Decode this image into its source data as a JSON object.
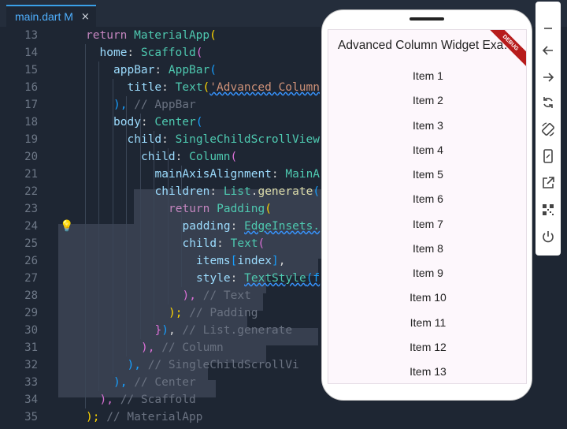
{
  "editor": {
    "tab": {
      "title": "main.dart M",
      "close": "×"
    },
    "lines": [
      {
        "n": "13",
        "indent": 1,
        "tokens": [
          [
            "return ",
            "kw"
          ],
          [
            "MaterialApp",
            "cls"
          ],
          [
            "(",
            "b1"
          ]
        ]
      },
      {
        "n": "14",
        "indent": 2,
        "tokens": [
          [
            "home",
            "prop"
          ],
          [
            ": ",
            "p"
          ],
          [
            "Scaffold",
            "cls"
          ],
          [
            "(",
            "b2"
          ]
        ]
      },
      {
        "n": "15",
        "indent": 3,
        "tokens": [
          [
            "appBar",
            "prop"
          ],
          [
            ": ",
            "p"
          ],
          [
            "AppBar",
            "cls"
          ],
          [
            "(",
            "b3"
          ]
        ]
      },
      {
        "n": "16",
        "indent": 4,
        "tokens": [
          [
            "title",
            "prop"
          ],
          [
            ": ",
            "p"
          ],
          [
            "Text",
            "cls"
          ],
          [
            "(",
            "b1"
          ],
          [
            "'Advanced Column",
            "str",
            "squig"
          ]
        ]
      },
      {
        "n": "17",
        "indent": 3,
        "tokens": [
          [
            "),",
            "b3"
          ],
          [
            " // AppBar",
            "cmt"
          ]
        ]
      },
      {
        "n": "18",
        "indent": 3,
        "tokens": [
          [
            "body",
            "prop"
          ],
          [
            ": ",
            "p"
          ],
          [
            "Center",
            "cls"
          ],
          [
            "(",
            "b3"
          ]
        ]
      },
      {
        "n": "19",
        "indent": 4,
        "tokens": [
          [
            "child",
            "prop"
          ],
          [
            ": ",
            "p"
          ],
          [
            "SingleChildScrollView",
            "cls"
          ]
        ]
      },
      {
        "n": "20",
        "indent": 5,
        "tokens": [
          [
            "child",
            "prop"
          ],
          [
            ": ",
            "p"
          ],
          [
            "Column",
            "cls"
          ],
          [
            "(",
            "b2"
          ]
        ]
      },
      {
        "n": "21",
        "indent": 6,
        "tokens": [
          [
            "mainAxisAlignment",
            "prop"
          ],
          [
            ": ",
            "p"
          ],
          [
            "MainA",
            "cls"
          ]
        ]
      },
      {
        "n": "22",
        "indent": 6,
        "tokens": [
          [
            "children",
            "prop"
          ],
          [
            ": ",
            "p"
          ],
          [
            "List",
            "cls"
          ],
          [
            ".",
            "p"
          ],
          [
            "generate",
            "fn"
          ],
          [
            "(",
            "b3"
          ]
        ]
      },
      {
        "n": "23",
        "indent": 7,
        "tokens": [
          [
            "return ",
            "kw"
          ],
          [
            "Padding",
            "cls"
          ],
          [
            "(",
            "b1"
          ]
        ]
      },
      {
        "n": "24",
        "indent": 8,
        "tokens": [
          [
            "padding",
            "prop"
          ],
          [
            ": ",
            "p"
          ],
          [
            "EdgeInsets.",
            "cls",
            "squig"
          ]
        ]
      },
      {
        "n": "25",
        "indent": 8,
        "tokens": [
          [
            "child",
            "prop"
          ],
          [
            ": ",
            "p"
          ],
          [
            "Text",
            "cls"
          ],
          [
            "(",
            "b2"
          ]
        ]
      },
      {
        "n": "26",
        "indent": 9,
        "tokens": [
          [
            "items",
            "prop"
          ],
          [
            "[",
            "b3"
          ],
          [
            "index",
            "prop"
          ],
          [
            "]",
            "b3"
          ],
          [
            ",",
            "p"
          ]
        ]
      },
      {
        "n": "27",
        "indent": 9,
        "tokens": [
          [
            "style",
            "prop"
          ],
          [
            ": ",
            "p"
          ],
          [
            "TextStyle",
            "cls",
            "squig"
          ],
          [
            "(f",
            "b3",
            "squig"
          ]
        ]
      },
      {
        "n": "28",
        "indent": 8,
        "tokens": [
          [
            "),",
            "b2"
          ],
          [
            " // Text",
            "cmt"
          ]
        ]
      },
      {
        "n": "29",
        "indent": 7,
        "tokens": [
          [
            ");",
            "b1"
          ],
          [
            " // Padding",
            "cmt"
          ]
        ]
      },
      {
        "n": "30",
        "indent": 6,
        "tokens": [
          [
            "}",
            "b2"
          ],
          [
            ")",
            "b3"
          ],
          [
            ",",
            "p"
          ],
          [
            " // List.generate",
            "cmt"
          ]
        ]
      },
      {
        "n": "31",
        "indent": 5,
        "tokens": [
          [
            "),",
            "b2"
          ],
          [
            " // Column",
            "cmt"
          ]
        ]
      },
      {
        "n": "32",
        "indent": 4,
        "tokens": [
          [
            "),",
            "b3"
          ],
          [
            " // SingleChildScrollVi",
            "cmt"
          ]
        ]
      },
      {
        "n": "33",
        "indent": 3,
        "tokens": [
          [
            "),",
            "b3"
          ],
          [
            " // Center",
            "cmt"
          ]
        ]
      },
      {
        "n": "34",
        "indent": 2,
        "tokens": [
          [
            "),",
            "b2"
          ],
          [
            " // Scaffold",
            "cmt"
          ]
        ]
      },
      {
        "n": "35",
        "indent": 1,
        "tokens": [
          [
            ");",
            "b1"
          ],
          [
            " // MaterialApp",
            "cmt"
          ]
        ]
      }
    ]
  },
  "emulator": {
    "app_title": "Advanced Column Widget Exam...",
    "debug_banner": "DEBUG",
    "items": [
      "Item 1",
      "Item 2",
      "Item 3",
      "Item 4",
      "Item 5",
      "Item 6",
      "Item 7",
      "Item 8",
      "Item 9",
      "Item 10",
      "Item 11",
      "Item 12",
      "Item 13"
    ]
  },
  "toolbar": {
    "buttons": [
      "minimize-icon",
      "back-icon",
      "forward-icon",
      "rotate-icon",
      "rotate-screen-icon",
      "resize-icon",
      "open-external-icon",
      "qr-code-icon",
      "power-icon"
    ]
  },
  "colors": {
    "editor_bg": "#1e2633",
    "tab_accent": "#3aa0e8",
    "tab_text": "#4fb0ff",
    "debug_ribbon": "#b71c1c",
    "emulator_screen": "#fdf7fc"
  }
}
